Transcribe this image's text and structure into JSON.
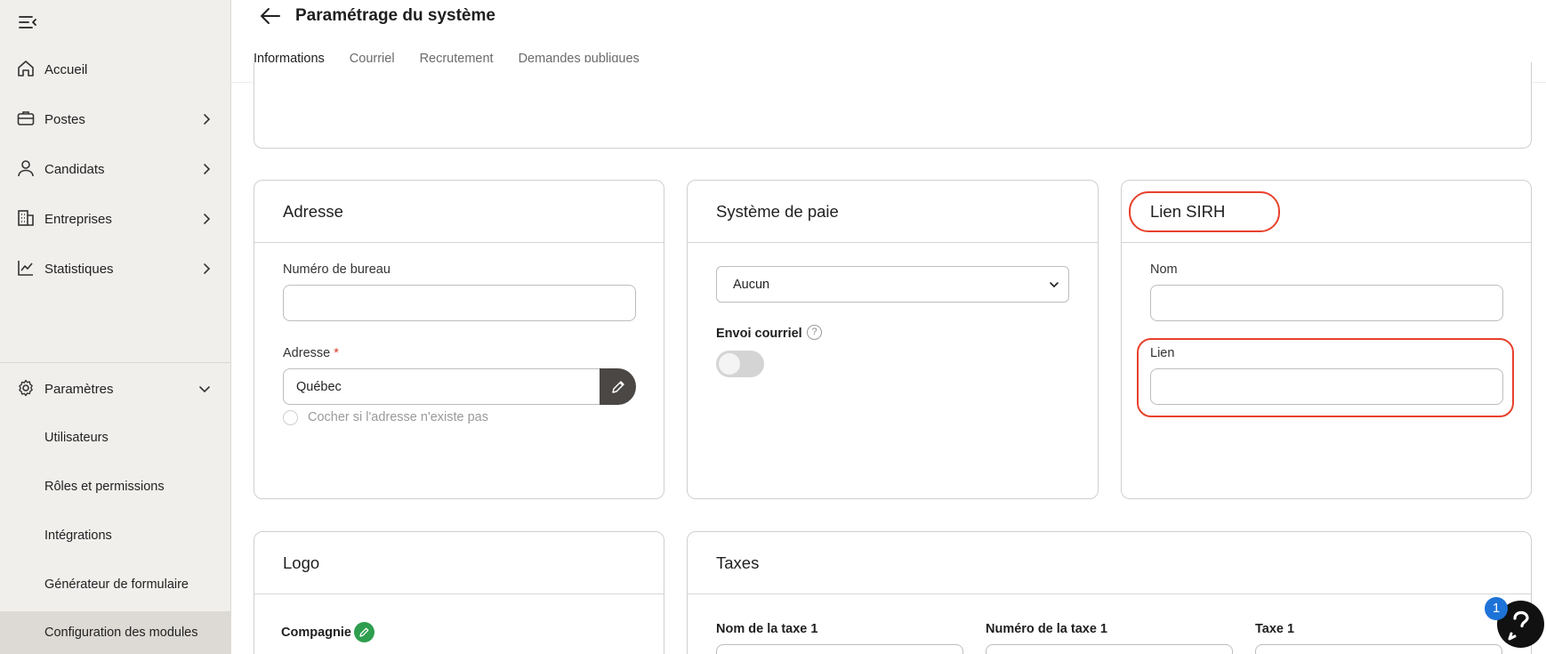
{
  "sidebar": {
    "nav": [
      {
        "label": "Accueil",
        "icon": "home-icon",
        "has_children": false
      },
      {
        "label": "Postes",
        "icon": "briefcase-icon",
        "has_children": true
      },
      {
        "label": "Candidats",
        "icon": "user-icon",
        "has_children": true
      },
      {
        "label": "Entreprises",
        "icon": "building-icon",
        "has_children": true
      },
      {
        "label": "Statistiques",
        "icon": "chart-icon",
        "has_children": true
      }
    ],
    "settings": {
      "label": "Paramètres",
      "icon": "gear-icon",
      "expanded": true,
      "items": [
        {
          "label": "Utilisateurs"
        },
        {
          "label": "Rôles et permissions"
        },
        {
          "label": "Intégrations"
        },
        {
          "label": "Générateur de formulaire"
        },
        {
          "label": "Configuration des modules",
          "active": true
        }
      ]
    }
  },
  "header": {
    "title": "Paramétrage du système",
    "tabs": [
      {
        "label": "Informations",
        "active": true
      },
      {
        "label": "Courriel"
      },
      {
        "label": "Recrutement"
      },
      {
        "label": "Demandes publiques"
      }
    ]
  },
  "address_card": {
    "title": "Adresse",
    "office_label": "Numéro de bureau",
    "office_value": "",
    "address_label": "Adresse",
    "required_mark": "*",
    "address_value": "Québec",
    "checkbox_label": "Cocher si l'adresse n'existe pas"
  },
  "payroll_card": {
    "title": "Système de paie",
    "select_value": "Aucun",
    "email_label": "Envoi courriel",
    "help_glyph": "?",
    "email_toggle_on": false
  },
  "sirh_card": {
    "title": "Lien SIRH",
    "name_label": "Nom",
    "name_value": "",
    "link_label": "Lien",
    "link_value": ""
  },
  "logo_card": {
    "title": "Logo",
    "company_label": "Compagnie"
  },
  "taxes_card": {
    "title": "Taxes",
    "columns": [
      "Nom de la taxe 1",
      "Numéro de la taxe 1",
      "Taxe 1"
    ]
  },
  "help_widget": {
    "badge_count": "1",
    "glyph": "?"
  },
  "colors": {
    "sidebar_bg": "#f1efec",
    "highlight": "#e8412c",
    "badge": "#1e73d8",
    "edit_green": "#2e9e4e"
  }
}
